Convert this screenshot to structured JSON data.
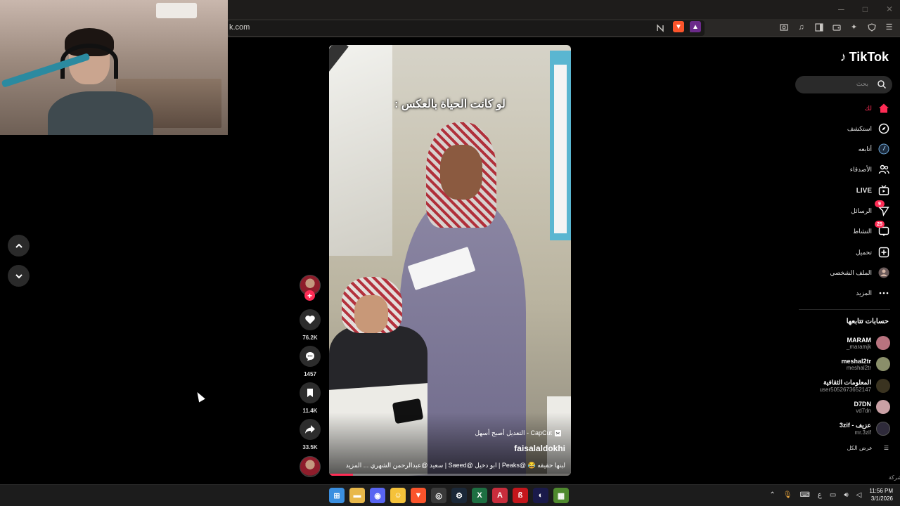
{
  "browser": {
    "url": "k.com",
    "window_controls": [
      "─",
      "□",
      "✕"
    ]
  },
  "video": {
    "top_caption": "لو كانت الحياة بالعكس :",
    "capcut_label": "CapCut - التعديل أصبح أسهل",
    "author": "faisalaldokhi",
    "description": "لبنها حقيقه 😂 @Peaks | ابو دخيل @Saeed | سعيد @عبدالرحمن الشهري ... المزيد",
    "progress": 0.1
  },
  "actions": {
    "likes": "76.2K",
    "comments": "1457",
    "saves": "11.4K",
    "shares": "33.5K"
  },
  "sidebar": {
    "logo": "TikTok",
    "search_placeholder": "بحث",
    "nav": [
      {
        "label": "لك",
        "icon": "home-icon",
        "active": true
      },
      {
        "label": "استكشف",
        "icon": "compass-icon"
      },
      {
        "label": "أتابعه",
        "icon": "following-icon"
      },
      {
        "label": "الأصدقاء",
        "icon": "friends-icon"
      },
      {
        "label": "LIVE",
        "icon": "live-icon"
      },
      {
        "label": "الرسائل",
        "icon": "messages-icon",
        "badge": "9"
      },
      {
        "label": "النشاط",
        "icon": "activity-icon",
        "badge": "25"
      },
      {
        "label": "تحميل",
        "icon": "upload-icon"
      },
      {
        "label": "الملف الشخصي",
        "icon": "profile-icon"
      },
      {
        "label": "المزيد",
        "icon": "more-icon"
      }
    ],
    "following_title": "حسابات تتابعها",
    "accounts": [
      {
        "name": "MARAM",
        "handle": "_maramjk",
        "color": "#b8737f"
      },
      {
        "name": "meshal2tr",
        "handle": "meshal2tr",
        "color": "#8a8f6a"
      },
      {
        "name": "المعلومات الثقافية",
        "handle": "user5052673652147",
        "color": "#3a3320"
      },
      {
        "name": "D7DN",
        "handle": "vd7dn",
        "color": "#caa0a5"
      },
      {
        "name": "3zif - عزيف",
        "handle": "mr.3zif",
        "color": "#2e2a3a"
      }
    ],
    "see_all": "عرض الكل",
    "company": "الشركة"
  },
  "taskbar": {
    "time": "11:56 PM",
    "date": "3/1/2026",
    "lang": "ع",
    "apps": [
      {
        "name": "windows-start",
        "color": "#3b8fe0",
        "glyph": "⊞"
      },
      {
        "name": "file-explorer",
        "color": "#e8b84a",
        "glyph": "▬"
      },
      {
        "name": "discord",
        "color": "#5865f2",
        "glyph": "◉"
      },
      {
        "name": "emoji-app",
        "color": "#f5c23a",
        "glyph": "☺"
      },
      {
        "name": "brave",
        "color": "#fb542b",
        "glyph": "▼"
      },
      {
        "name": "obs",
        "color": "#3a3a3a",
        "glyph": "◎"
      },
      {
        "name": "steam",
        "color": "#1b2838",
        "glyph": "⚙"
      },
      {
        "name": "excel",
        "color": "#1d6f42",
        "glyph": "X"
      },
      {
        "name": "app-a",
        "color": "#c82d3c",
        "glyph": "A"
      },
      {
        "name": "app-red",
        "color": "#c4161c",
        "glyph": "ß"
      },
      {
        "name": "app-blue",
        "color": "#1a1a4a",
        "glyph": "◐"
      },
      {
        "name": "minecraft",
        "color": "#4f8a2e",
        "glyph": "▦"
      }
    ]
  }
}
